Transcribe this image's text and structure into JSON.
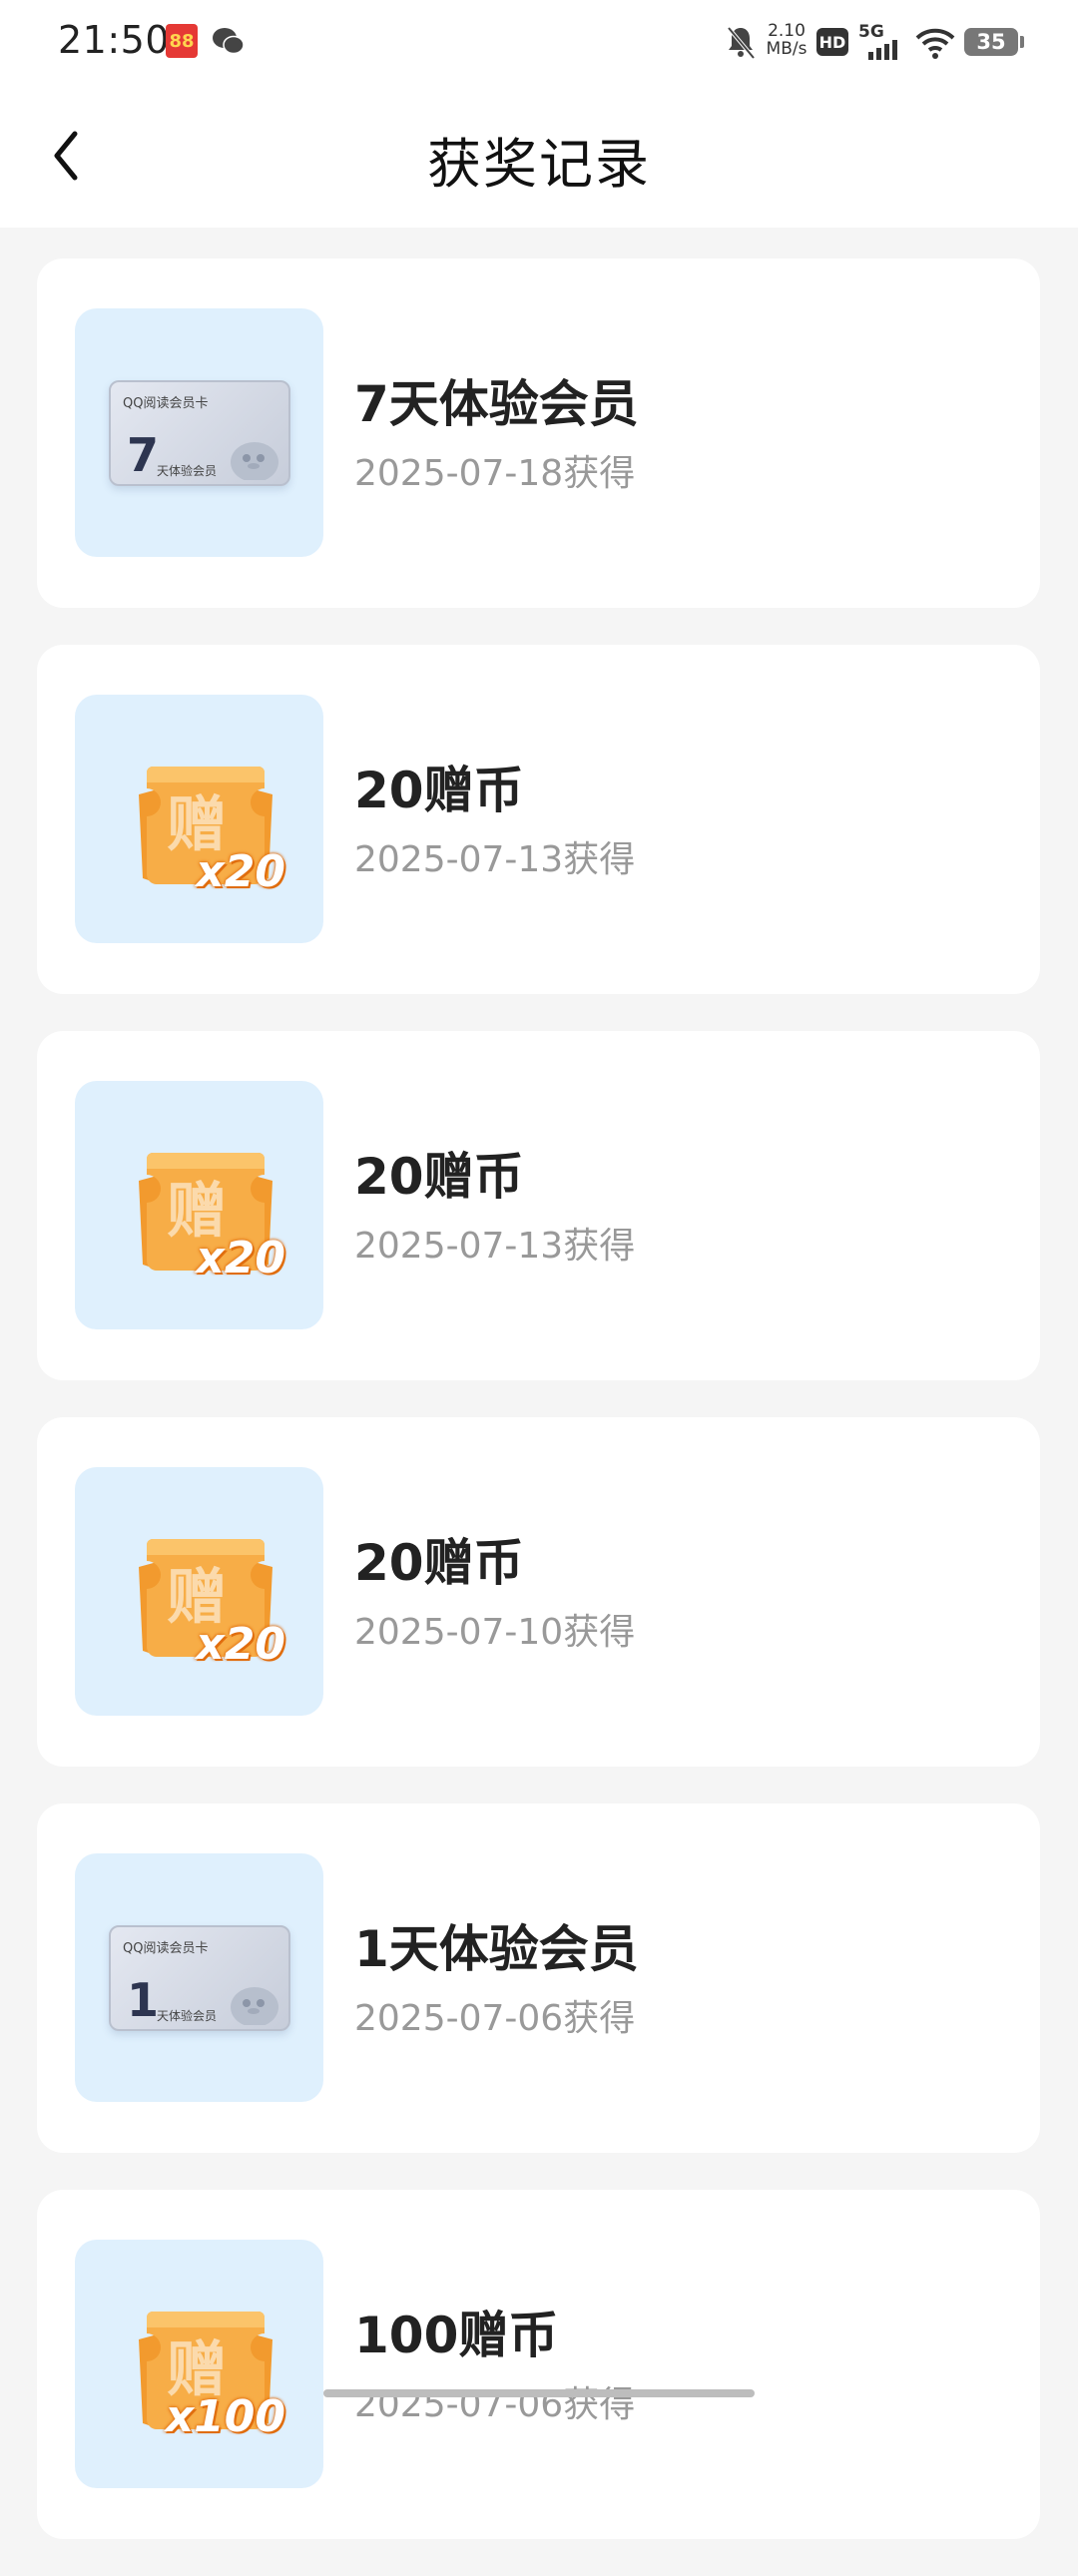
{
  "status_bar": {
    "time": "21:50",
    "app_icon_text": "88",
    "net_speed_value": "2.10",
    "net_speed_unit": "MB/s",
    "hd_label": "HD",
    "network_label": "5G",
    "battery_level": "35"
  },
  "nav": {
    "title": "获奖记录",
    "back_icon": "chevron-left-icon"
  },
  "records": [
    {
      "title": "7天体验会员",
      "date": "2025-07-18获得",
      "kind": "member-card",
      "card_header": "QQ阅读会员卡",
      "card_number": "7",
      "card_sub": "天体验会员"
    },
    {
      "title": "20赠币",
      "date": "2025-07-13获得",
      "kind": "coin-ticket",
      "coin_char": "赠",
      "multiplier": "x20"
    },
    {
      "title": "20赠币",
      "date": "2025-07-13获得",
      "kind": "coin-ticket",
      "coin_char": "赠",
      "multiplier": "x20"
    },
    {
      "title": "20赠币",
      "date": "2025-07-10获得",
      "kind": "coin-ticket",
      "coin_char": "赠",
      "multiplier": "x20"
    },
    {
      "title": "1天体验会员",
      "date": "2025-07-06获得",
      "kind": "member-card",
      "card_header": "QQ阅读会员卡",
      "card_number": "1",
      "card_sub": "天体验会员"
    },
    {
      "title": "100赠币",
      "date": "2025-07-06获得",
      "kind": "coin-ticket",
      "coin_char": "赠",
      "multiplier": "x100"
    }
  ],
  "colors": {
    "page_bg": "#f5f5f5",
    "card_bg": "#ffffff",
    "thumb_bg": "#dff0fd",
    "title_text": "#222222",
    "date_text": "#999999",
    "coin_orange": "#f7a53b"
  }
}
